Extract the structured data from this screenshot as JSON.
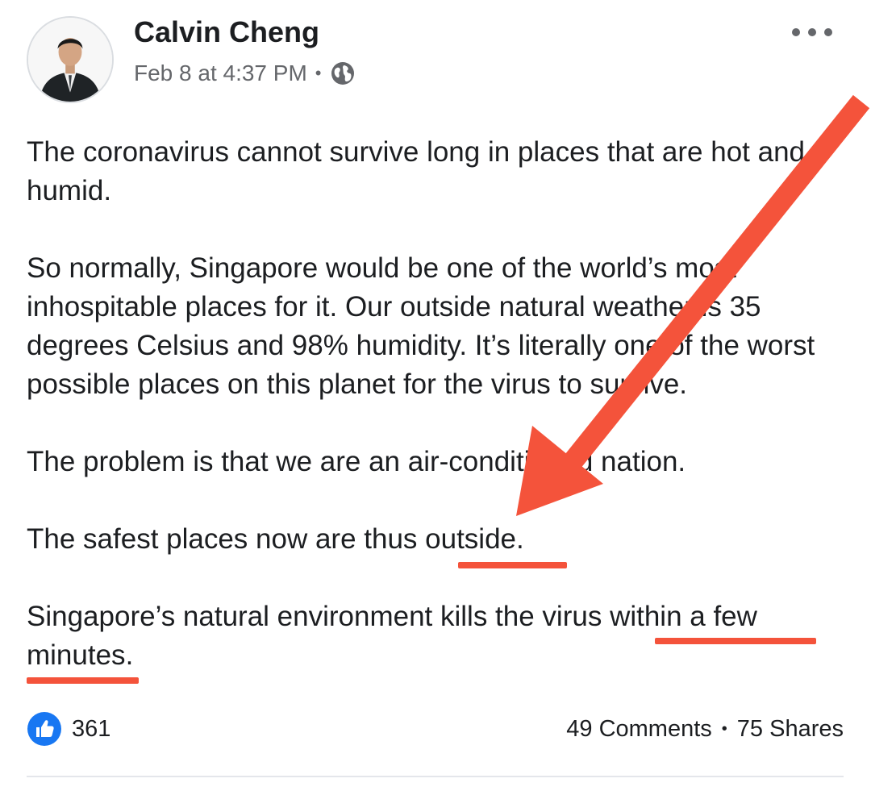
{
  "post": {
    "author": "Calvin Cheng",
    "timestamp": "Feb 8 at 4:37 PM",
    "separator": "•",
    "audience_icon": "globe-icon",
    "paragraphs": {
      "p1": "The coronavirus cannot survive long in places that are hot and humid.",
      "p2": "So normally, Singapore would be one of the world’s most inhospitable places for it.  Our outside natural weather is 35 degrees Celsius and 98% humidity. It’s literally one of the worst possible places on this planet for the virus to survive.",
      "p3": "The problem is that we are an air-conditioned nation.",
      "p4_prefix": "The safest places now are thus ",
      "p4_underlined": "outside.",
      "p5_prefix": "Singapore’s natural environment kills the virus ",
      "p5_underlined": "within a few minutes",
      "p5_suffix": "."
    }
  },
  "stats": {
    "likes": "361",
    "comments": "49 Comments",
    "separator": "•",
    "shares": "75 Shares"
  },
  "annotation": {
    "color": "#f4533b",
    "arrow_icon": "red-arrow-annotation"
  },
  "colors": {
    "like_blue": "#1877f2",
    "meta_grey": "#65676b"
  }
}
